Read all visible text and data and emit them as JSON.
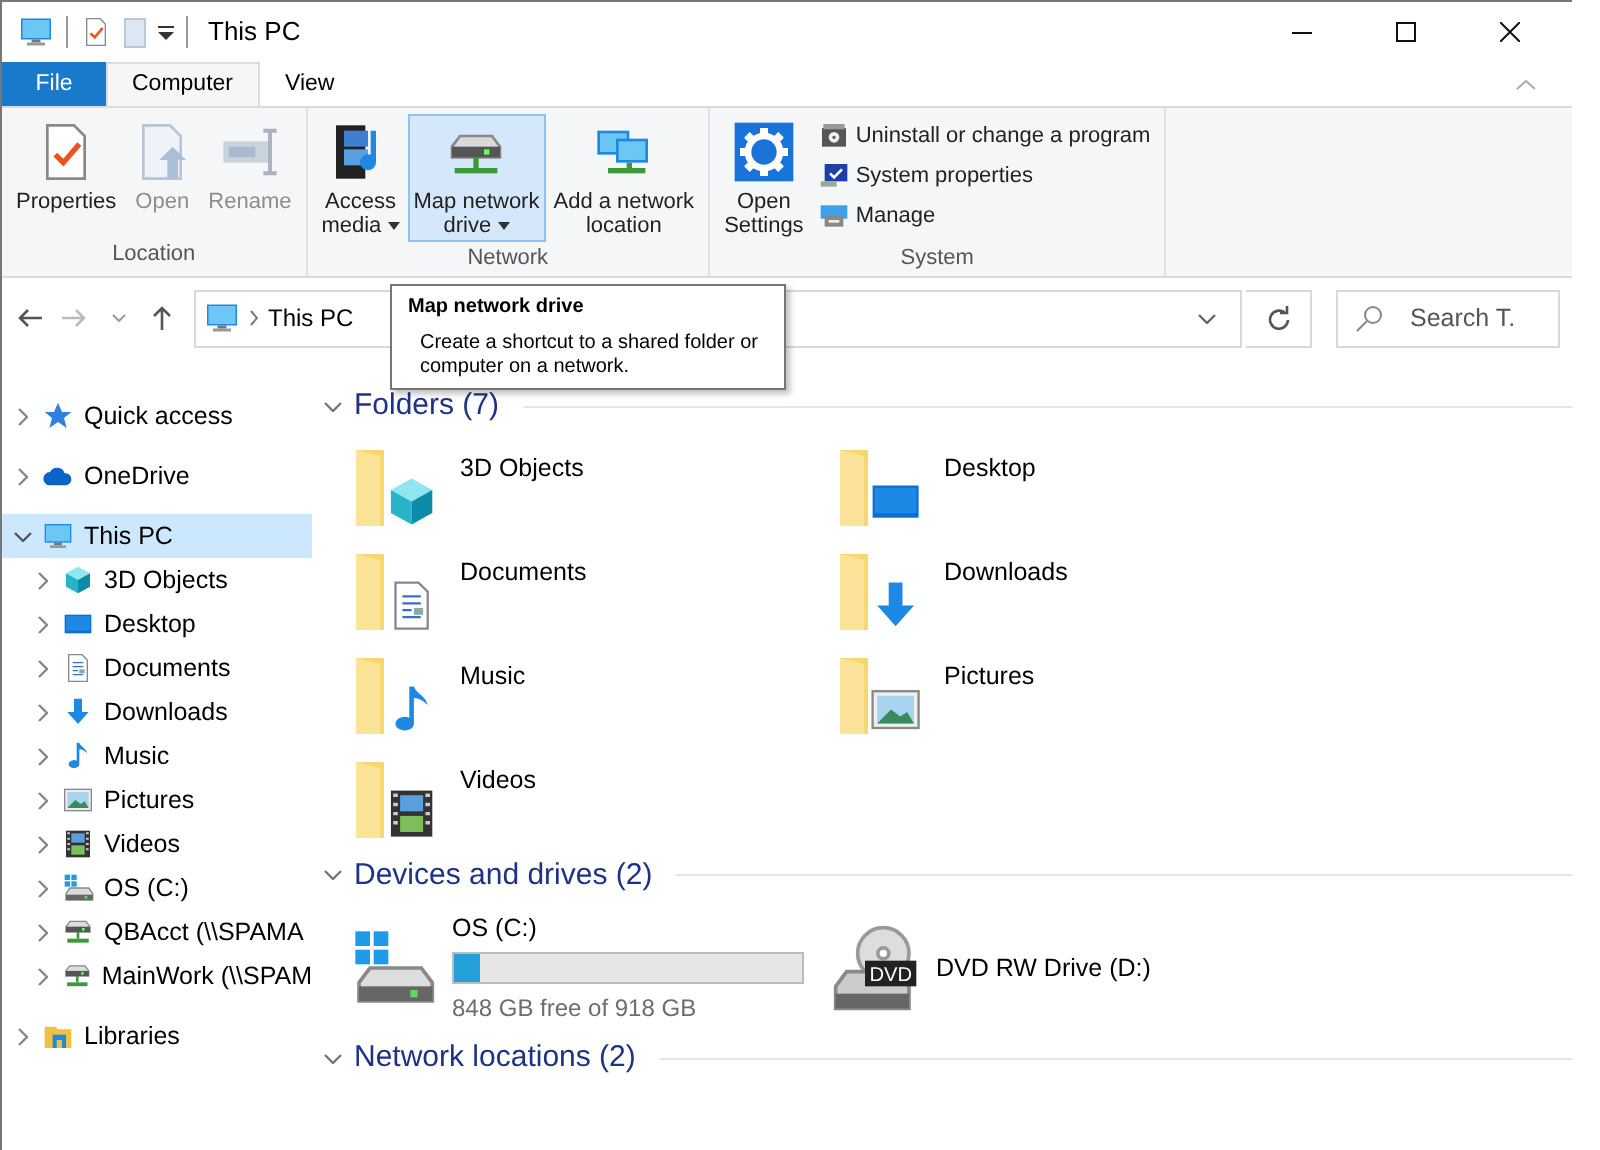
{
  "window": {
    "title": "This PC"
  },
  "ribbon": {
    "tabs": [
      {
        "label": "File",
        "kind": "file",
        "selected": false
      },
      {
        "label": "Computer",
        "kind": "tab",
        "selected": true
      },
      {
        "label": "View",
        "kind": "tab",
        "selected": false
      }
    ],
    "groups": [
      {
        "label": "Location",
        "buttons": [
          {
            "kind": "large",
            "lines": [
              "Properties"
            ],
            "disabled": false,
            "dropdown": false,
            "hovered": false
          },
          {
            "kind": "large",
            "lines": [
              "Open"
            ],
            "disabled": true,
            "dropdown": false,
            "hovered": false
          },
          {
            "kind": "large",
            "lines": [
              "Rename"
            ],
            "disabled": true,
            "dropdown": false,
            "hovered": false
          }
        ]
      },
      {
        "label": "Network",
        "buttons": [
          {
            "kind": "large",
            "lines": [
              "Access",
              "media"
            ],
            "disabled": false,
            "dropdown": true,
            "hovered": false
          },
          {
            "kind": "large",
            "lines": [
              "Map network",
              "drive"
            ],
            "disabled": false,
            "dropdown": true,
            "hovered": true
          },
          {
            "kind": "large",
            "lines": [
              "Add a network",
              "location"
            ],
            "disabled": false,
            "dropdown": false,
            "hovered": false
          }
        ]
      },
      {
        "label": "System",
        "buttons": [
          {
            "kind": "large",
            "lines": [
              "Open",
              "Settings"
            ],
            "disabled": false,
            "dropdown": false,
            "hovered": false
          },
          {
            "kind": "small",
            "lines": [
              "Uninstall or change a program"
            ],
            "disabled": false,
            "dropdown": false,
            "hovered": false
          },
          {
            "kind": "small",
            "lines": [
              "System properties"
            ],
            "disabled": false,
            "dropdown": false,
            "hovered": false
          },
          {
            "kind": "small",
            "lines": [
              "Manage"
            ],
            "disabled": false,
            "dropdown": false,
            "hovered": false
          }
        ]
      }
    ]
  },
  "tooltip": {
    "title": "Map network drive",
    "text": "Create a shortcut to a shared folder or computer on a network."
  },
  "address": {
    "path": "This PC"
  },
  "search": {
    "placeholder": "Search T."
  },
  "navigation": [
    {
      "label": "Quick access",
      "selected": false,
      "expanded": false
    },
    {
      "label": "OneDrive",
      "selected": false,
      "expanded": false
    },
    {
      "label": "This PC",
      "selected": true,
      "expanded": true,
      "children": [
        {
          "label": "3D Objects",
          "selected": false,
          "expanded": false
        },
        {
          "label": "Desktop",
          "selected": false,
          "expanded": false
        },
        {
          "label": "Documents",
          "selected": false,
          "expanded": false
        },
        {
          "label": "Downloads",
          "selected": false,
          "expanded": false
        },
        {
          "label": "Music",
          "selected": false,
          "expanded": false
        },
        {
          "label": "Pictures",
          "selected": false,
          "expanded": false
        },
        {
          "label": "Videos",
          "selected": false,
          "expanded": false
        },
        {
          "label": "OS (C:)",
          "selected": false,
          "expanded": false
        },
        {
          "label": "QBAcct (\\\\SPAMA",
          "selected": false,
          "expanded": false
        },
        {
          "label": "MainWork (\\\\SPAM",
          "selected": false,
          "expanded": false
        }
      ]
    },
    {
      "label": "Libraries",
      "selected": false,
      "expanded": false
    }
  ],
  "sections": [
    {
      "title": "Folders (7)",
      "expanded": true,
      "items": [
        {
          "kind": "folder",
          "name": "3D Objects"
        },
        {
          "kind": "folder",
          "name": "Desktop"
        },
        {
          "kind": "folder",
          "name": "Documents"
        },
        {
          "kind": "folder",
          "name": "Downloads"
        },
        {
          "kind": "folder",
          "name": "Music"
        },
        {
          "kind": "folder",
          "name": "Pictures"
        },
        {
          "kind": "folder",
          "name": "Videos"
        }
      ]
    },
    {
      "title": "Devices and drives (2)",
      "expanded": true,
      "items": [
        {
          "kind": "drive",
          "name": "OS (C:)",
          "level": 0.076,
          "detail": "848 GB free of 918 GB"
        },
        {
          "kind": "drive",
          "name": "DVD RW Drive (D:)",
          "icon_label": "DVD"
        }
      ]
    },
    {
      "title": "Network locations (2)",
      "expanded": true
    }
  ]
}
